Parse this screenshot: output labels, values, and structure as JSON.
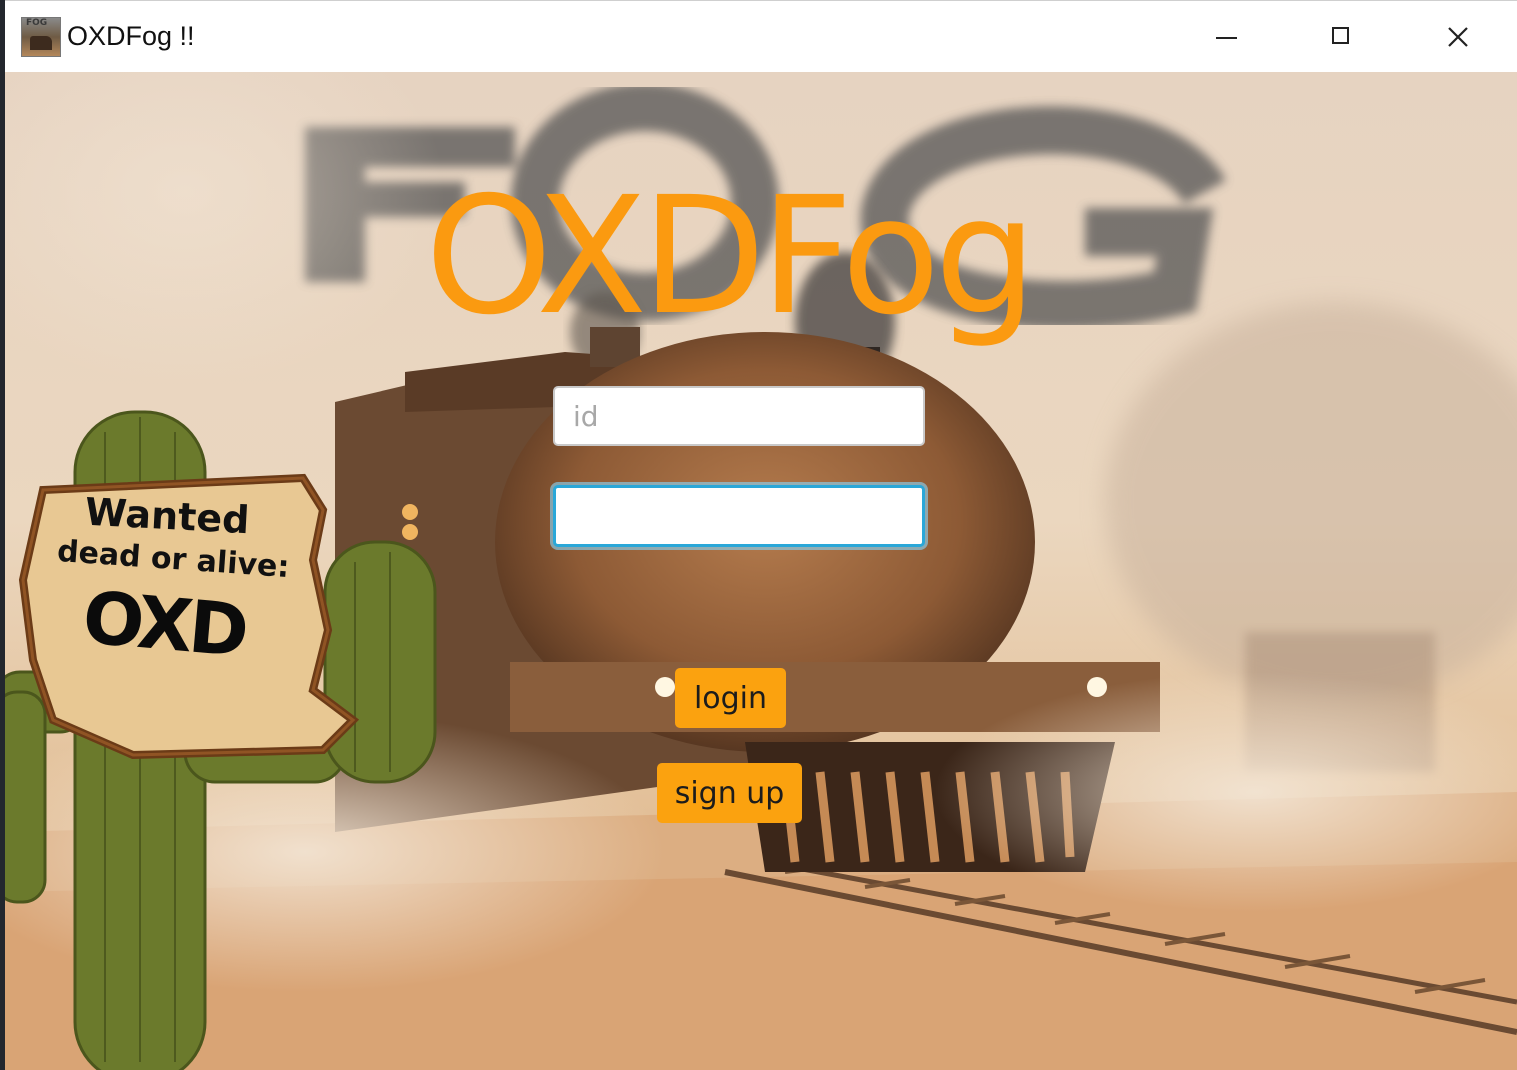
{
  "window": {
    "title": "OXDFog !!",
    "controls": {
      "minimize_icon": "minimize-icon",
      "maximize_icon": "maximize-icon",
      "close_icon": "close-icon"
    }
  },
  "logo": {
    "text": "OXDFog",
    "color": "#fb9a10"
  },
  "form": {
    "id_placeholder": "id",
    "id_value": "",
    "password_value": "",
    "login_label": "login",
    "signup_label": "sign up",
    "button_color": "#fba20f",
    "focus_color": "#2aa7d8"
  },
  "sign": {
    "line1": "Wanted",
    "line2": "dead or alive:",
    "line3": "OXD"
  }
}
